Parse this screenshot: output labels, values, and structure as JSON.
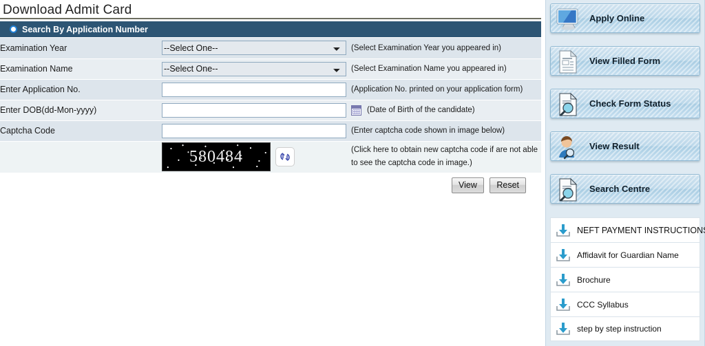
{
  "page": {
    "title": "Download Admit Card"
  },
  "panel": {
    "header": "Search By Application Number",
    "radio_icon": "radio-selected-icon",
    "rows": [
      {
        "label": "Examination Year",
        "control": "select",
        "value": "--Select One--",
        "hint": "(Select Examination Year you appeared in)"
      },
      {
        "label": "Examination Name",
        "control": "select",
        "value": "--Select One--",
        "hint": "(Select Examination Name you appeared in)"
      },
      {
        "label": "Enter Application No.",
        "control": "text",
        "value": "",
        "placeholder": "",
        "hint": "(Application No. printed on your application form)"
      },
      {
        "label": "Enter DOB(dd-Mon-yyyy)",
        "control": "text-date",
        "value": "",
        "placeholder": "",
        "icon": "calendar-icon",
        "hint": "(Date of Birth of the candidate)"
      },
      {
        "label": "Captcha Code",
        "control": "text",
        "value": "",
        "placeholder": "",
        "hint": "(Enter captcha code shown in image below)"
      }
    ],
    "captcha": {
      "code": "580484",
      "refresh_icon": "refresh-icon",
      "hint": "(Click here to obtain new captcha code if are not able to see the captcha code in image.)"
    },
    "buttons": {
      "view": "View",
      "reset": "Reset"
    }
  },
  "sidebar": {
    "nav": [
      {
        "label": "Apply Online",
        "icon": "monitor-icon"
      },
      {
        "label": "View Filled Form",
        "icon": "document-form-icon"
      },
      {
        "label": "Check Form Status",
        "icon": "document-search-icon"
      },
      {
        "label": "View Result",
        "icon": "user-icon"
      },
      {
        "label": "Search Centre",
        "icon": "document-search-icon"
      }
    ],
    "downloads": [
      {
        "label": "NEFT PAYMENT INSTRUCTIONS",
        "icon": "download-icon"
      },
      {
        "label": "Affidavit for Guardian Name",
        "icon": "download-icon"
      },
      {
        "label": "Brochure",
        "icon": "download-icon"
      },
      {
        "label": "CCC Syllabus",
        "icon": "download-icon"
      },
      {
        "label": "step by step instruction",
        "icon": "download-icon"
      }
    ]
  },
  "colors": {
    "panel_header": "#2d5574",
    "accent_blue": "#1f7fd4",
    "sidebar_bg": "#dfeaf2",
    "row_alt": "#dde5ec"
  }
}
